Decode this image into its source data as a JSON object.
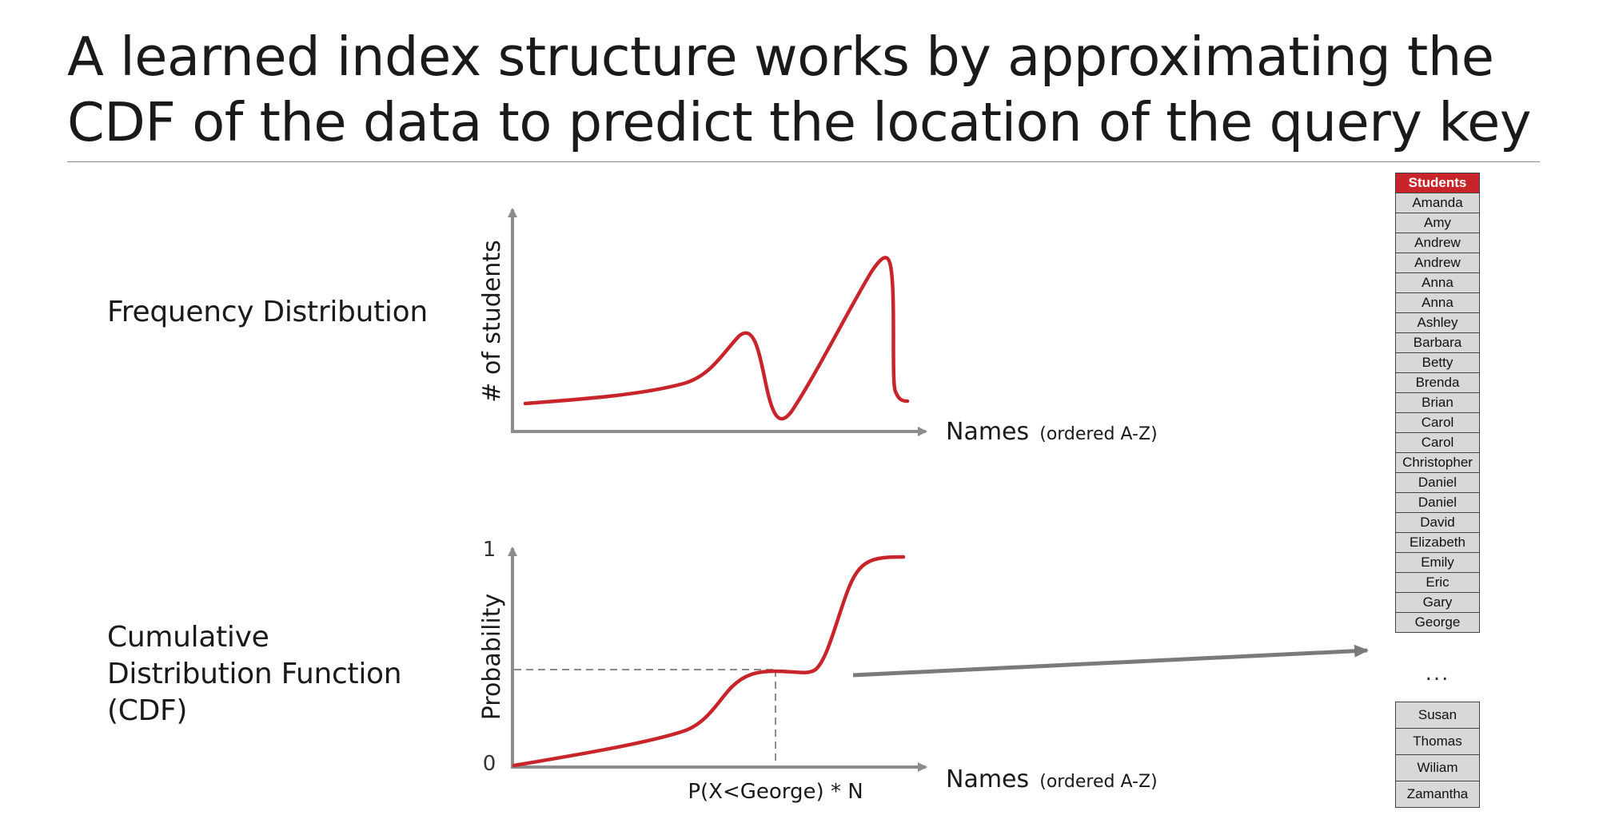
{
  "title": "A learned index structure works by approximating the CDF of the data to predict the location of the query key",
  "frequency": {
    "label": "Frequency Distribution",
    "y_axis_label": "# of students",
    "x_axis_label": "Names",
    "x_axis_note": "(ordered A-Z)"
  },
  "cdf": {
    "label": "Cumulative Distribution Function (CDF)",
    "y_axis_label": "Probability",
    "y_tick_top": "1",
    "y_tick_bottom": "0",
    "x_axis_label": "Names",
    "x_axis_note": "(ordered A-Z)",
    "marker_label": "P(X<George) * N"
  },
  "table": {
    "header": "Students",
    "rows": [
      "Amanda",
      "Amy",
      "Andrew",
      "Andrew",
      "Anna",
      "Anna",
      "Ashley",
      "Barbara",
      "Betty",
      "Brenda",
      "Brian",
      "Carol",
      "Carol",
      "Christopher",
      "Daniel",
      "Daniel",
      "David",
      "Elizabeth",
      "Emily",
      "Eric",
      "Gary",
      "George"
    ],
    "ellipsis": "...",
    "tail_rows": [
      "Susan",
      "Thomas",
      "Wiliam",
      "Zamantha"
    ]
  },
  "colors": {
    "curve": "#c8252b",
    "axis": "#8c8c8c",
    "header_bg": "#c8252b",
    "cell_bg": "#d8d8d8"
  }
}
